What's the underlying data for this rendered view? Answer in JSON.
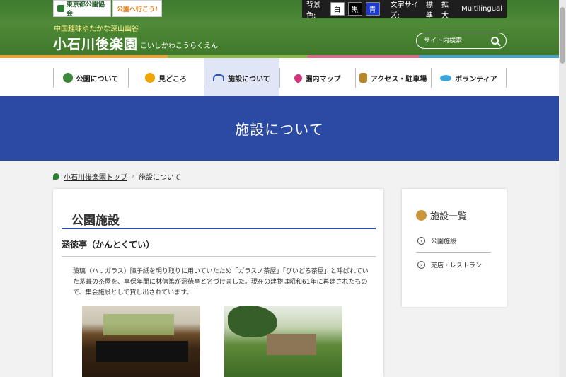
{
  "header": {
    "logo1": "東京都公園協会",
    "logo2": "公園へ行こう!",
    "bg_label": "背景色:",
    "bg_white": "白",
    "bg_black": "黒",
    "bg_blue": "青",
    "font_label": "文字サイズ:",
    "font_normal": "標準",
    "font_large": "拡大",
    "multilingual": "Multilingual",
    "subtitle": "中国趣味ゆたかな深山幽谷",
    "site_name": "小石川後楽園",
    "site_reading": "こいしかわこうらくえん",
    "search_placeholder": "サイト内検索"
  },
  "nav": {
    "items": [
      {
        "label": "公園について",
        "icon": "tree-icon"
      },
      {
        "label": "見どころ",
        "icon": "highlight-icon"
      },
      {
        "label": "施設について",
        "icon": "mountain-icon"
      },
      {
        "label": "園内マップ",
        "icon": "map-pin-icon"
      },
      {
        "label": "アクセス・駐車場",
        "icon": "train-icon"
      },
      {
        "label": "ボランティア",
        "icon": "volunteer-icon"
      }
    ]
  },
  "banner": {
    "title": "施設について"
  },
  "breadcrumb": {
    "home": "小石川後楽園トップ",
    "current": "施設について"
  },
  "main": {
    "heading": "公園施設",
    "subheading": "涵徳亭（かんとくてい）",
    "body": "玻璃（ハリガラス）障子紙を明り取りに用いていたため「ガラスノ茶屋」「びいどろ茶屋」と呼ばれていた茅葺の茶屋を、享保年間に林信篤が涵徳亭と名づけました。現在の建物は昭和61年に再建されたもので、集会施設として貸し出されています。"
  },
  "side": {
    "heading": "施設一覧",
    "links": [
      "公園施設",
      "売店・レストラン"
    ]
  },
  "colors": {
    "banner": "#2b4aa4",
    "header": "#4e8a37"
  }
}
